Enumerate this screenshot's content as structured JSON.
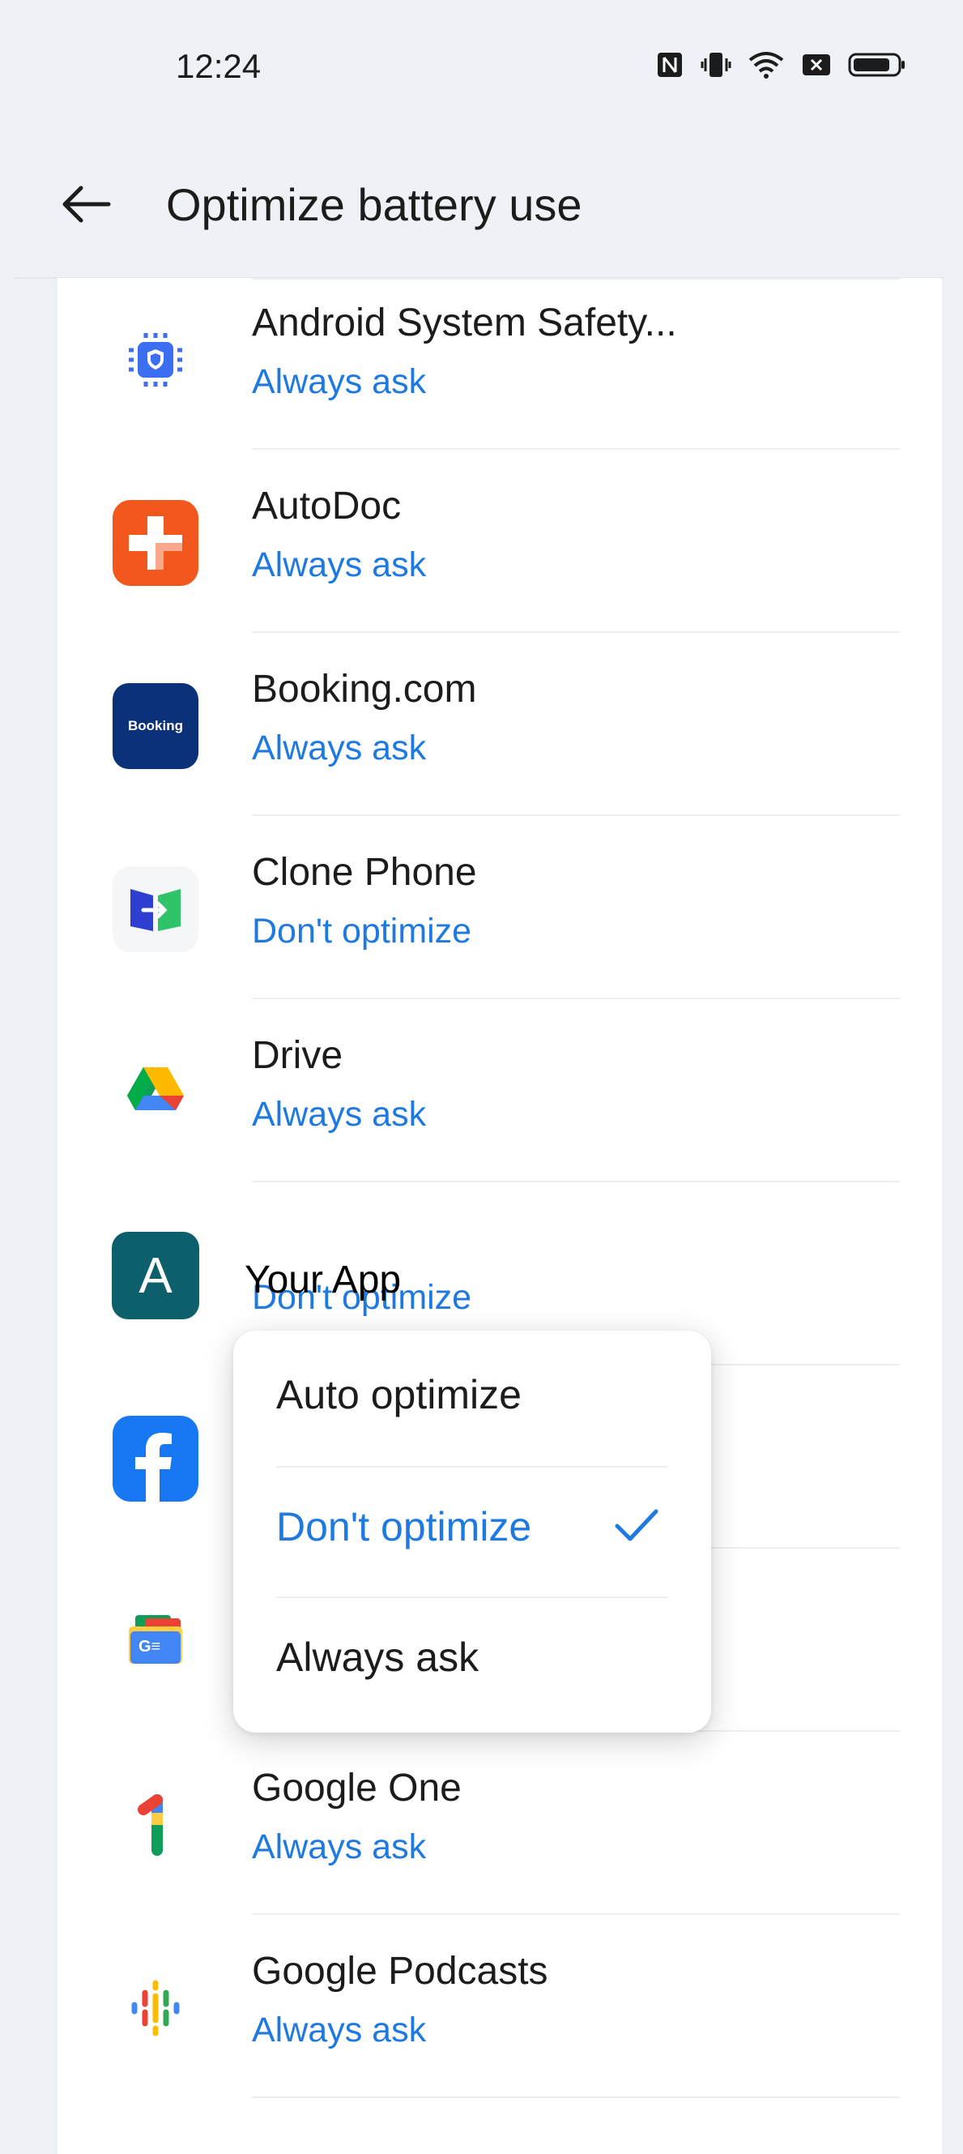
{
  "status_bar": {
    "time": "12:24"
  },
  "header": {
    "title": "Optimize battery use"
  },
  "apps": [
    {
      "name": "Android System Safety...",
      "status": "Always ask"
    },
    {
      "name": "AutoDoc",
      "status": "Always ask"
    },
    {
      "name": "Booking.com",
      "status": "Always ask",
      "icon_text": "Booking"
    },
    {
      "name": "Clone Phone",
      "status": "Don't optimize"
    },
    {
      "name": "Drive",
      "status": "Always ask"
    },
    {
      "name": "",
      "status": "Don't optimize",
      "icon_text": "A"
    },
    {
      "name": "",
      "status": ""
    },
    {
      "name": "",
      "status": "",
      "icon_text": "G≡"
    },
    {
      "name": "Google One",
      "status": "Always ask"
    },
    {
      "name": "Google Podcasts",
      "status": "Always ask"
    }
  ],
  "overlay_label": "Your App",
  "popup": {
    "options": [
      "Auto optimize",
      "Don't optimize",
      "Always ask"
    ],
    "selected": "Don't optimize"
  },
  "colors": {
    "accent": "#1e7ae0",
    "background": "#eef2f6",
    "card": "#ffffff"
  }
}
